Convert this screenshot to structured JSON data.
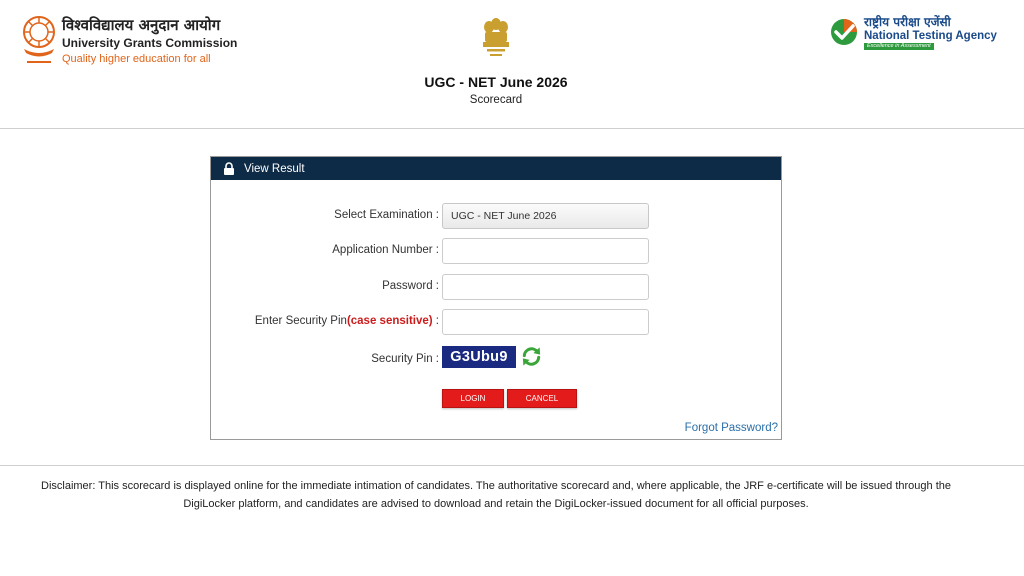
{
  "header": {
    "ugc": {
      "hindi_name": "विश्वविद्यालय अनुदान आयोग",
      "name": "University Grants Commission",
      "tagline": "Quality higher education for all"
    },
    "title": "UGC - NET June 2026",
    "subtitle": "Scorecard",
    "nta": {
      "hindi_name": "राष्ट्रीय परीक्षा एजेंसी",
      "name": "National Testing Agency",
      "badge": "Excellence in Assessment"
    }
  },
  "card": {
    "title": "View Result",
    "fields": {
      "exam_label": "Select Examination :",
      "exam_value": "UGC - NET June 2026",
      "application_label": "Application Number :",
      "application_value": "",
      "password_label": "Password :",
      "password_value": "",
      "pin_label_prefix": "Enter Security Pin",
      "pin_label_note": "(case sensitive)",
      "pin_label_suffix": " :",
      "pin_value": "",
      "security_pin_label": "Security Pin :",
      "security_pin_code": "G3Ubu9"
    },
    "buttons": {
      "login": "LOGIN",
      "cancel": "CANCEL"
    },
    "forgot_password": "Forgot Password?"
  },
  "disclaimer": "Disclaimer: This scorecard is displayed online for the immediate intimation of candidates. The authoritative scorecard and, where applicable, the JRF e-certificate will be issued through the DigiLocker platform, and candidates are advised to download and retain the DigiLocker-issued document for all official purposes.",
  "icons": [
    "ugc-logo-icon",
    "national-emblem-icon",
    "nta-logo-icon",
    "lock-icon",
    "refresh-icon"
  ],
  "colors": {
    "card_header": "#0d2a47",
    "button": "#e31b1b",
    "captcha_bg": "#1a2a80",
    "tagline": "#e0651b",
    "link": "#2a6fa8",
    "nta_text": "#1a4a8a",
    "nta_badge": "#2e9a3e"
  }
}
